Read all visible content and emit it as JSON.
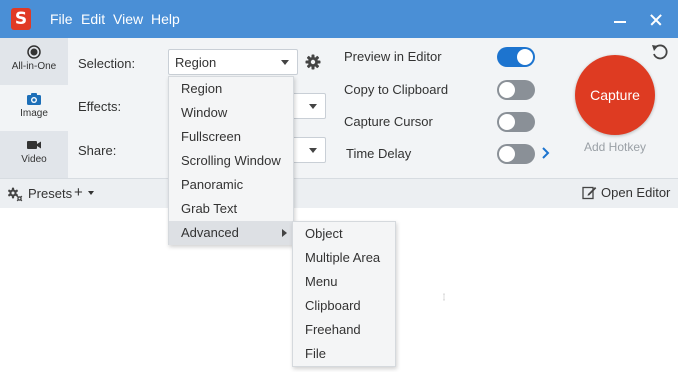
{
  "app": {
    "logo_letter": "S"
  },
  "menubar": {
    "items": [
      "File",
      "Edit",
      "View",
      "Help"
    ]
  },
  "sidebar": {
    "tabs": [
      {
        "label": "All-in-One",
        "icon": "record-icon",
        "active": false
      },
      {
        "label": "Image",
        "icon": "camera-icon",
        "active": true
      },
      {
        "label": "Video",
        "icon": "video-camera-icon",
        "active": false
      }
    ]
  },
  "settings": {
    "selection_label": "Selection:",
    "selection_value": "Region",
    "effects_label": "Effects:",
    "share_label": "Share:"
  },
  "options": {
    "preview_in_editor": {
      "label": "Preview in Editor",
      "on": true
    },
    "copy_to_clipboard": {
      "label": "Copy to Clipboard",
      "on": false
    },
    "capture_cursor": {
      "label": "Capture Cursor",
      "on": false
    },
    "time_delay": {
      "label": "Time Delay",
      "on": false
    }
  },
  "capture": {
    "label": "Capture",
    "hotkey_label": "Add Hotkey",
    "color": "#de3b22"
  },
  "bottombar": {
    "presets_label": "Presets",
    "add_label": "+",
    "open_editor_label": "Open Editor"
  },
  "selection_dropdown": {
    "items": [
      "Region",
      "Window",
      "Fullscreen",
      "Scrolling Window",
      "Panoramic",
      "Grab Text",
      "Advanced"
    ],
    "highlighted": "Advanced"
  },
  "advanced_submenu": {
    "items": [
      "Object",
      "Multiple Area",
      "Menu",
      "Clipboard",
      "Freehand",
      "File"
    ]
  },
  "colors": {
    "titlebar": "#4a8fd6",
    "toggle_on": "#1d74cf",
    "toggle_off": "#8a9097"
  }
}
